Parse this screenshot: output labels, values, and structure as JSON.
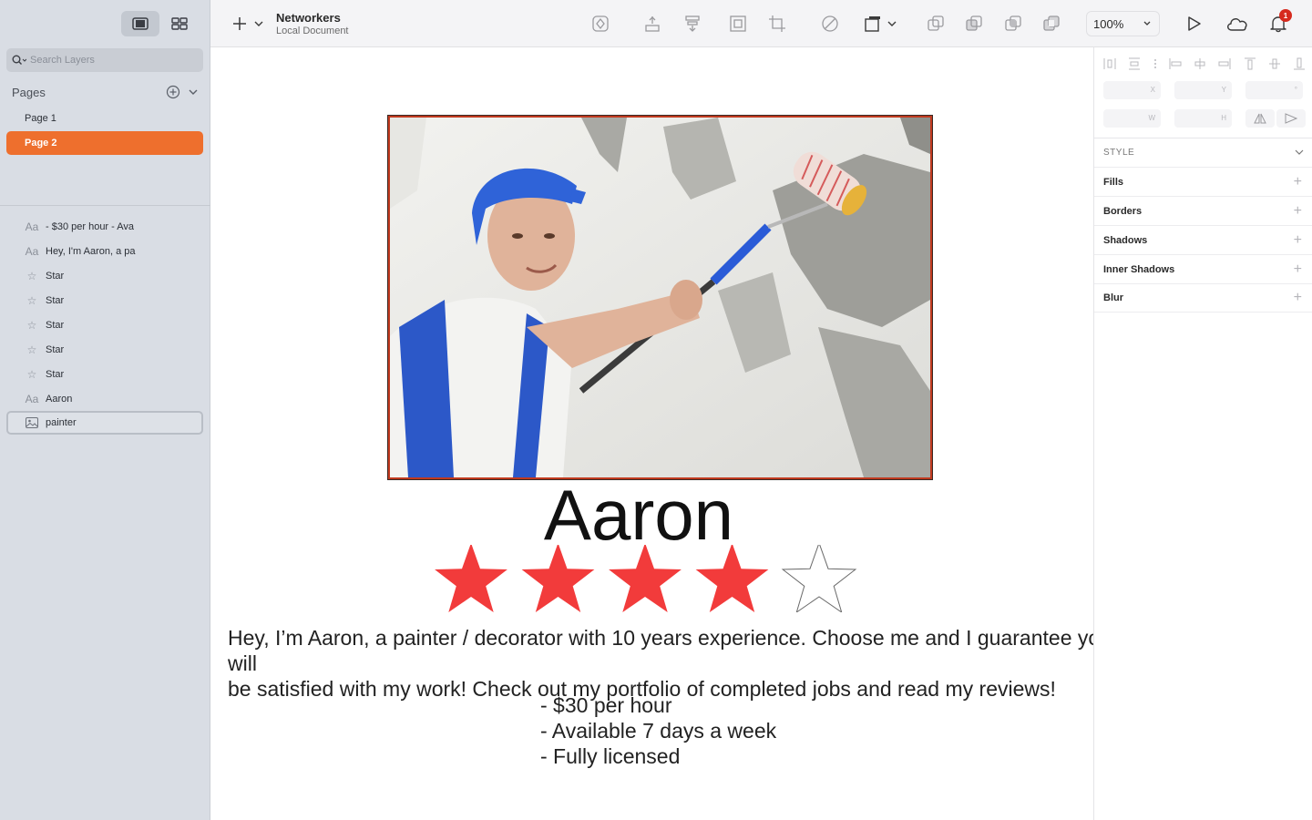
{
  "sidebar": {
    "search_placeholder": "Search Layers",
    "pages_title": "Pages",
    "pages": [
      {
        "label": "Page 1",
        "selected": false
      },
      {
        "label": "Page 2",
        "selected": true
      }
    ],
    "layers": [
      {
        "label": "- $30 per hour - Ava",
        "icon": "text-icon"
      },
      {
        "label": "Hey, I'm Aaron, a pa",
        "icon": "text-icon"
      },
      {
        "label": "Star",
        "icon": "star-icon"
      },
      {
        "label": "Star",
        "icon": "star-icon"
      },
      {
        "label": "Star",
        "icon": "star-icon"
      },
      {
        "label": "Star",
        "icon": "star-icon"
      },
      {
        "label": "Star",
        "icon": "star-icon"
      },
      {
        "label": "Aaron",
        "icon": "text-icon"
      },
      {
        "label": "painter",
        "icon": "image-icon",
        "selected": true
      }
    ]
  },
  "toolbar": {
    "doc_title": "Networkers",
    "doc_subtitle": "Local Document",
    "zoom": "100%",
    "notification_count": "1"
  },
  "canvas": {
    "name": "Aaron",
    "rating": 4,
    "rating_max": 5,
    "bio": "Hey, I’m Aaron, a painter / decorator with 10 years experience. Choose me and I guarantee you will\nbe satisfied with my work! Check out my portfolio of completed jobs and read my reviews!",
    "details": [
      "- $30 per hour",
      "- Available 7 days a week",
      "- Fully licensed"
    ],
    "star_fill": "#f23b3b"
  },
  "inspector": {
    "x_label": "X",
    "y_label": "Y",
    "rotation_label": "°",
    "w_label": "W",
    "h_label": "H",
    "style_header": "STYLE",
    "sections": [
      "Fills",
      "Borders",
      "Shadows",
      "Inner Shadows",
      "Blur"
    ]
  },
  "colors": {
    "accent": "#ee6f2d",
    "sidebar_bg": "#d9dde4",
    "badge": "#d62a1e"
  }
}
